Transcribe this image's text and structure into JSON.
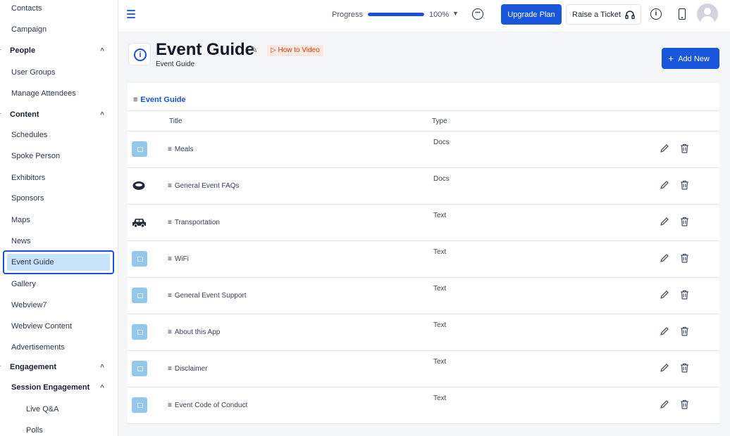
{
  "sidebar": {
    "items": [
      {
        "label": "Contacts",
        "type": "item"
      },
      {
        "label": "Campaign",
        "type": "item"
      },
      {
        "label": "People",
        "type": "group",
        "chevron": "^"
      },
      {
        "label": "User Groups",
        "type": "item"
      },
      {
        "label": "Manage Attendees",
        "type": "item"
      },
      {
        "label": "Content",
        "type": "group",
        "chevron": "^"
      },
      {
        "label": "Schedules",
        "type": "item"
      },
      {
        "label": "Spoke Person",
        "type": "item"
      },
      {
        "label": "Exhibitors",
        "type": "item"
      },
      {
        "label": "Sponsors",
        "type": "item"
      },
      {
        "label": "Maps",
        "type": "item"
      },
      {
        "label": "News",
        "type": "item"
      },
      {
        "label": "Event Guide",
        "type": "item",
        "active": true
      },
      {
        "label": "Gallery",
        "type": "item"
      },
      {
        "label": "Webview7",
        "type": "item"
      },
      {
        "label": "Webview Content",
        "type": "item"
      },
      {
        "label": "Advertisements",
        "type": "item"
      },
      {
        "label": "Engagement",
        "type": "group",
        "chevron": "^"
      },
      {
        "label": "Session Engagement",
        "type": "subgroup",
        "chevron": "^"
      },
      {
        "label": "Live Q&A",
        "type": "sub"
      },
      {
        "label": "Polls",
        "type": "sub"
      }
    ]
  },
  "topbar": {
    "progress_label": "Progress",
    "progress_value": 100,
    "progress_text": "100%",
    "upgrade_label": "Upgrade Plan",
    "ticket_label": "Raise a Ticket"
  },
  "header": {
    "title": "Event Guide",
    "subtitle": "Event Guide",
    "video_label": "▷ How to Video",
    "add_label": "Add New"
  },
  "table": {
    "section_title": "Event Guide",
    "columns": {
      "title": "Title",
      "type": "Type"
    },
    "rows": [
      {
        "title": "Meals",
        "type": "Docs",
        "icon": "image-placeholder-icon"
      },
      {
        "title": "General Event FAQs",
        "type": "Docs",
        "icon": "ring-icon"
      },
      {
        "title": "Transportation",
        "type": "Text",
        "icon": "car-icon"
      },
      {
        "title": "WiFi",
        "type": "Text",
        "icon": "image-placeholder-icon"
      },
      {
        "title": "General Event Support",
        "type": "Text",
        "icon": "image-placeholder-icon"
      },
      {
        "title": "About this App",
        "type": "Text",
        "icon": "image-placeholder-icon"
      },
      {
        "title": "Disclaimer",
        "type": "Text",
        "icon": "image-placeholder-icon"
      },
      {
        "title": "Event Code of Conduct",
        "type": "Text",
        "icon": "image-placeholder-icon"
      }
    ]
  },
  "colors": {
    "accent": "#1a56db",
    "active_bg": "#c7e3fb",
    "video_bg": "#fde7e1",
    "video_text": "#c2410c"
  }
}
